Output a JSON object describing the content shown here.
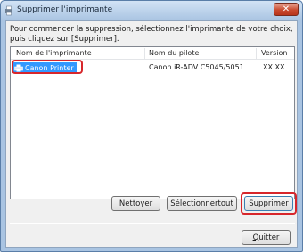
{
  "window": {
    "title": "Supprimer l'imprimante",
    "close_symbol": "✕"
  },
  "intro_text": "Pour commencer la suppression, sélectionnez l'imprimante de votre choix, puis cliquez sur [Supprimer].",
  "list": {
    "columns": [
      "Nom de l'imprimante",
      "Nom du pilote",
      "Version"
    ],
    "rows": [
      {
        "printer_name": "Canon Printer",
        "driver_name": "Canon iR-ADV C5045/5051 ...",
        "version": "XX.XX",
        "selected": true
      }
    ]
  },
  "buttons": {
    "clean_prefix": "N",
    "clean_underlined": "e",
    "clean_suffix": "ttoyer",
    "select_all_prefix": "Sélectionner ",
    "select_all_underlined": "t",
    "select_all_suffix": "out",
    "delete_underlined": "S",
    "delete_suffix": "upprimer",
    "quit_underlined": "Q",
    "quit_suffix": "uitter"
  },
  "colors": {
    "selection": "#3399ff",
    "callout": "#d7262b",
    "close_button": "#c94a2f"
  },
  "icons": {
    "app": "printer-icon",
    "row": "printer-icon",
    "close": "close-icon"
  }
}
